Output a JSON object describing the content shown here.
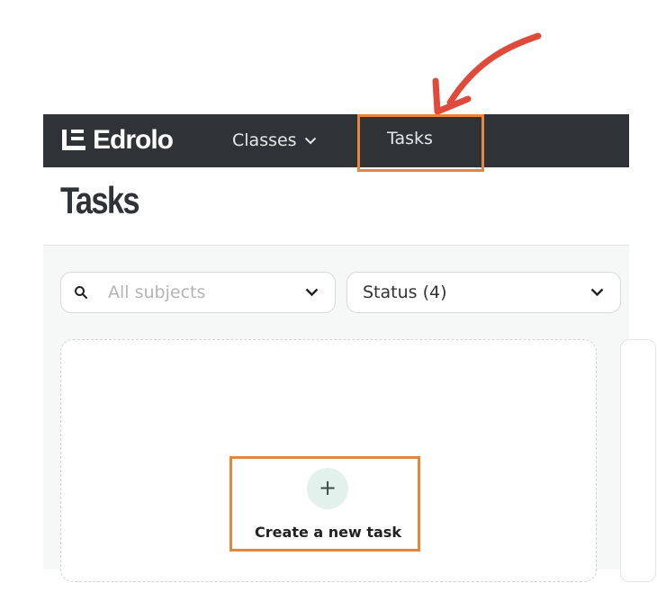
{
  "brand": {
    "name": "Edrolo",
    "mark_icon": "edrolo-logo-icon"
  },
  "nav": {
    "classes_label": "Classes",
    "tasks_label": "Tasks",
    "classes_icon": "chevron-down-icon"
  },
  "page": {
    "title": "Tasks"
  },
  "filters": {
    "subjects_placeholder": "All subjects",
    "status_label": "Status (4)"
  },
  "create_task": {
    "icon": "plus-icon",
    "label": "Create a new task"
  },
  "annotations": {
    "arrow_icon": "red-arrow-icon",
    "arrow_color": "#e04a3a",
    "highlight_color": "#e5853f"
  },
  "colors": {
    "topbar": "#2f3337",
    "plus_bg": "#e2f1ec"
  }
}
